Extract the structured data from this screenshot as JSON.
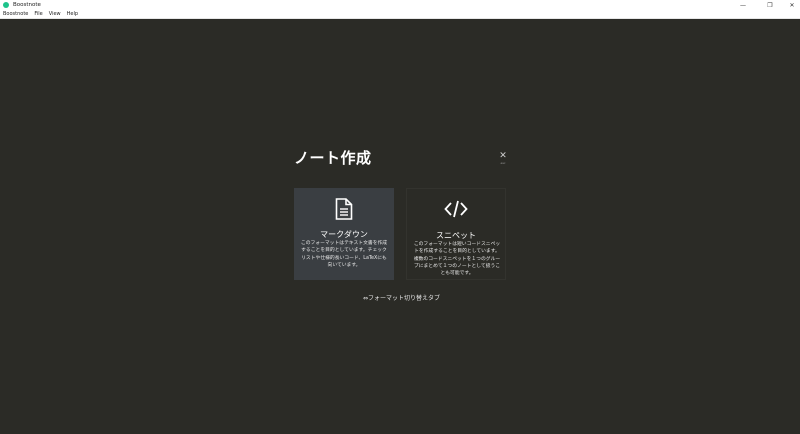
{
  "window": {
    "title": "Boostnote",
    "controls": {
      "minimize": "—",
      "maximize": "❐",
      "close": "✕"
    }
  },
  "menu": [
    "Boostnote",
    "File",
    "View",
    "Help"
  ],
  "modal": {
    "title": "ノート作成",
    "close": {
      "icon": "✕",
      "label": "esc"
    },
    "cards": [
      {
        "icon": "file-text-icon",
        "name": "マークダウン",
        "description": "このフォーマットはテキスト文書を作成することを目的としています。チェックリストや仕様的長いコード、LaTeXにも向いています。"
      },
      {
        "icon": "code-icon",
        "name": "スニペット",
        "description": "このフォーマットは短いコードスニペットを作成することを目的としています。複数のコードスニペットを１つのグループにまとめて１つのノートとして扱うことも可能です。"
      }
    ],
    "hint": "⇔フォーマット切り替えタブ"
  },
  "colors": {
    "background": "#2b2b26",
    "selected_card": "#3a3e42",
    "app_icon": "#1ec38b"
  }
}
